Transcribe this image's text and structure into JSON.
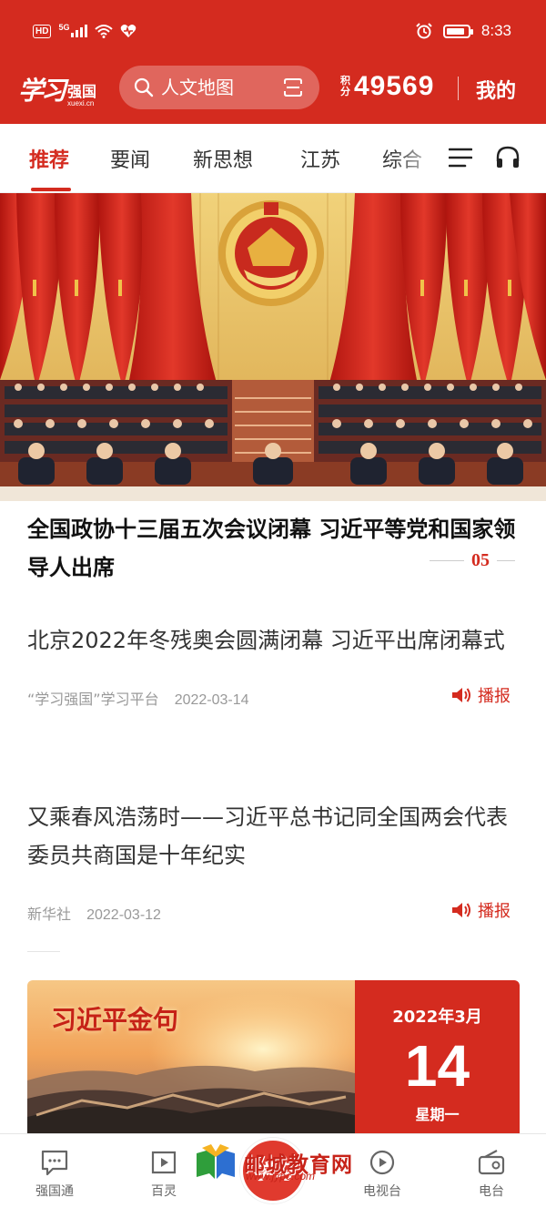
{
  "status_bar": {
    "hd": "HD",
    "network": "5G",
    "time": "8:33",
    "battery_level": 0.85,
    "icons": [
      "signal-icon",
      "wifi-icon",
      "heart-icon",
      "alarm-icon",
      "battery-icon"
    ]
  },
  "header": {
    "logo_script": "学习",
    "logo_cn": "强国",
    "logo_url": "xuexi.cn",
    "search_placeholder": "人文地图",
    "points_label_1": "积",
    "points_label_2": "分",
    "points_value": "49569",
    "mine_label": "我的"
  },
  "tabs": [
    {
      "label": "推荐",
      "active": true
    },
    {
      "label": "要闻"
    },
    {
      "label": "新思想"
    },
    {
      "label": "江苏"
    },
    {
      "label": "综合"
    }
  ],
  "hero": {
    "headline": "全国政协十三届五次会议闭幕 习近平等党和国家领导人出席",
    "pager": "05"
  },
  "news": [
    {
      "title": "北京2022年冬残奥会圆满闭幕 习近平出席闭幕式",
      "source": "“学习强国”学习平台",
      "date": "2022-03-14",
      "action": "播报"
    },
    {
      "title": "又乘春风浩荡时——习近平总书记同全国两会代表委员共商国是十年纪实",
      "source": "新华社",
      "date": "2022-03-12",
      "action": "播报"
    }
  ],
  "quote_card": {
    "title": "习近平金句",
    "year_month": "2022年3月",
    "day": "14",
    "weekday": "星期一"
  },
  "bottom_nav": [
    {
      "label": "强国通",
      "icon": "chat-icon"
    },
    {
      "label": "百灵",
      "icon": "play-box-icon"
    },
    {
      "label": "学习",
      "icon": "study-logo-icon"
    },
    {
      "label": "电视台",
      "icon": "tv-play-icon"
    },
    {
      "label": "电台",
      "icon": "radio-icon"
    }
  ],
  "watermark": {
    "text": "邮城教育网",
    "url": "www.jypc.com"
  },
  "colors": {
    "brand_red": "#d42b1f",
    "text_dark": "#333333",
    "text_meta": "#999999"
  }
}
